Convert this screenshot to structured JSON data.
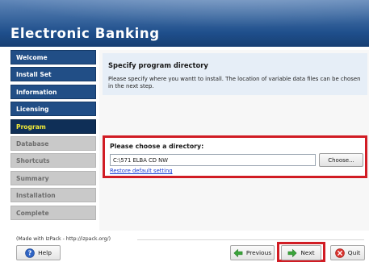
{
  "window": {
    "title": "Electronic Banking"
  },
  "sidebar": {
    "items": [
      {
        "label": "Welcome",
        "state": "done"
      },
      {
        "label": "Install Set",
        "state": "done"
      },
      {
        "label": "Information",
        "state": "done"
      },
      {
        "label": "Licensing",
        "state": "done"
      },
      {
        "label": "Program",
        "state": "current"
      },
      {
        "label": "Database",
        "state": "todo"
      },
      {
        "label": "Shortcuts",
        "state": "todo"
      },
      {
        "label": "Summary",
        "state": "todo"
      },
      {
        "label": "Installation",
        "state": "todo"
      },
      {
        "label": "Complete",
        "state": "todo"
      }
    ]
  },
  "main": {
    "heading": "Specify program directory",
    "description": "Please specify where you wantt to install. The location of variable data files can be chosen in the next step.",
    "directory": {
      "label": "Please choose a directory:",
      "value": "C:\\571 ELBA CD NW",
      "choose_label": "Choose...",
      "restore_label": "Restore default setting"
    }
  },
  "footer": {
    "made_with": "(Made with IzPack - http://izpack.org/)",
    "help_label": "Help",
    "previous_label": "Previous",
    "next_label": "Next",
    "quit_label": "Quit"
  },
  "colors": {
    "header_blue": "#1f4f8c",
    "nav_done": "#214e86",
    "nav_current": "#0f2f57",
    "nav_current_text": "#f2ea38",
    "nav_todo": "#c9c9c9",
    "highlight_red": "#d11c24",
    "link_blue": "#1b3fd6"
  },
  "icons": {
    "help": "help-icon",
    "previous": "arrow-left-icon",
    "next": "arrow-right-icon",
    "quit": "quit-icon"
  }
}
